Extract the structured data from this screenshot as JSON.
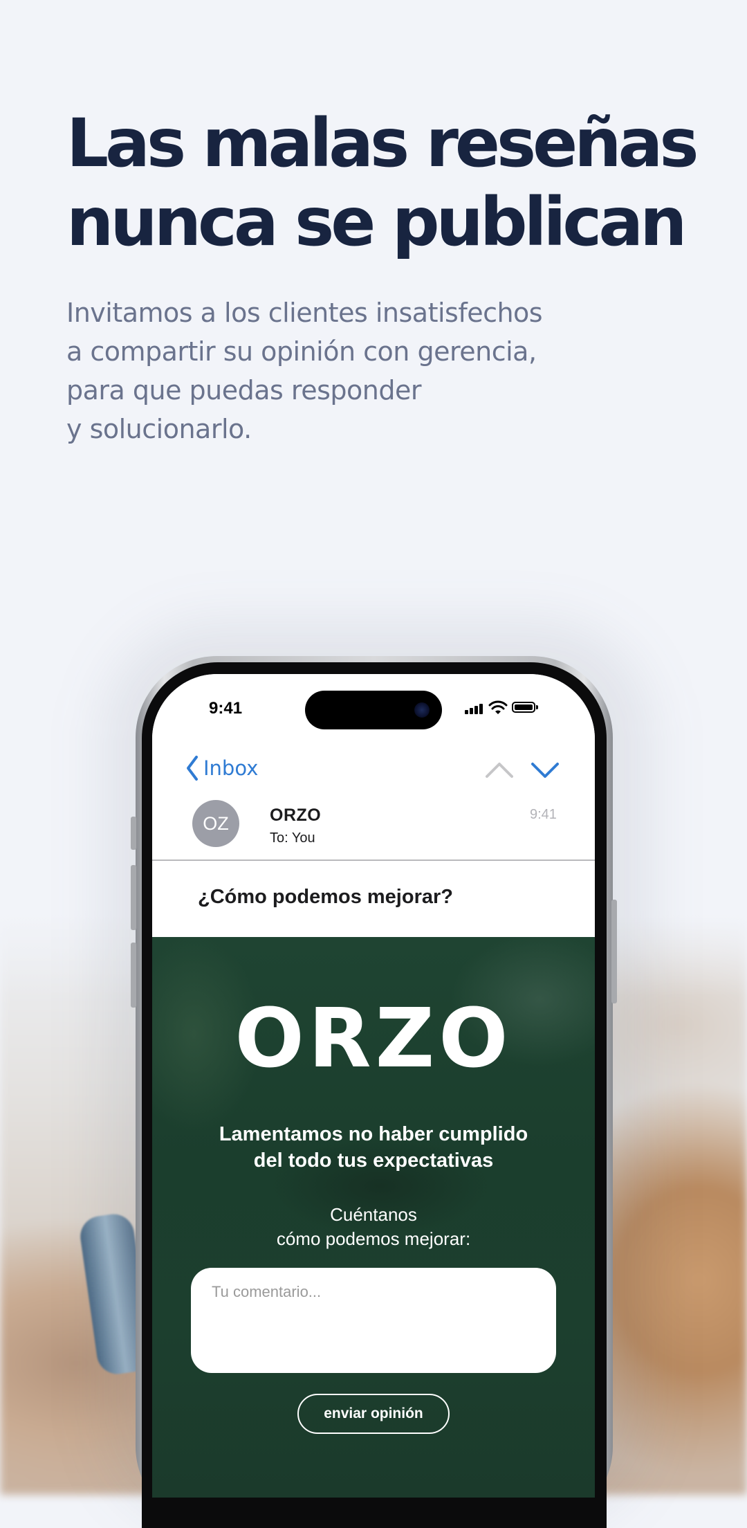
{
  "hero": {
    "headline_line1": "Las malas reseñas",
    "headline_line2": "nunca se publican",
    "subtext_lines": [
      "Invitamos a los clientes insatisfechos",
      "a compartir su opinión con gerencia,",
      "para que puedas responder",
      "y solucionarlo."
    ]
  },
  "status_bar": {
    "time": "9:41"
  },
  "mail_nav": {
    "back_label": "Inbox"
  },
  "message": {
    "avatar_initials": "OZ",
    "sender": "ORZO",
    "recipient": "To: You",
    "time": "9:41",
    "subject": "¿Cómo podemos mejorar?"
  },
  "email_content": {
    "brand": "ORZO",
    "apology_line1": "Lamentamos no haber cumplido",
    "apology_line2": "del todo tus expectativas",
    "prompt_line1": "Cuéntanos",
    "prompt_line2": "cómo podemos mejorar:",
    "comment_placeholder": "Tu comentario...",
    "submit_label": "enviar opinión"
  },
  "colors": {
    "headline": "#182440",
    "subtext": "#6a738d",
    "ios_blue": "#2f7bd3",
    "email_bg": "#1c3f2e",
    "avatar_bg": "#9c9ea7"
  }
}
